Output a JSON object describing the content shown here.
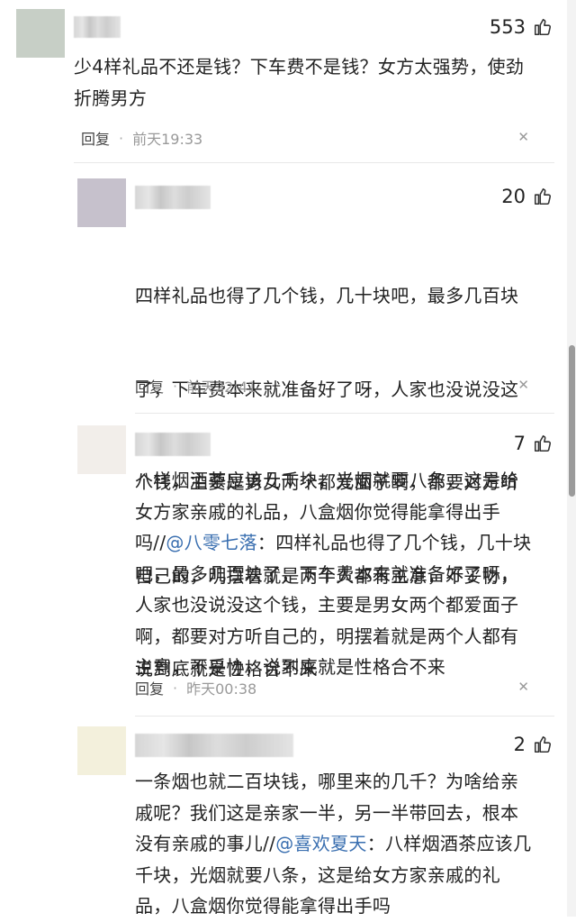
{
  "comments": [
    {
      "likes": "553",
      "text": "少4样礼品不还是钱？下车费不是钱？女方太强势，使劲折腾男方",
      "reply_label": "回复",
      "time": "前天19:33",
      "avatar_color": "#c7cfc6"
    },
    {
      "likes": "20",
      "text_lines": [
        "四样礼品也得了几个钱，几十块吧，最多几百块",
        "了，下车费本来就准备好了呀，人家也没说没这",
        "个钱，主要是男女两个都爱面子啊，都要对方听",
        "自己的，明摆着就是两个人都有主意，不妥协，",
        "说到底就是性格合不来"
      ],
      "reply_label": "回复",
      "time": "前天22:41",
      "avatar_color": "#c6c1cc"
    },
    {
      "likes": "7",
      "text_pre": "八样烟酒茶应该几千块，光烟就要八条，这是给女方家亲戚的礼品，八盒烟你觉得能拿得出手吗//",
      "mention": "@八零七落",
      "text_post": "：四样礼品也得了几个钱，几十块吧，最多几百块了，下车费本来就准备好了呀，人家也没说没这个钱，主要是男女两个都爱面子啊，都要对方听自己的，明摆着就是两个人都有主意，不妥协，说到底就是性格合不来",
      "reply_label": "回复",
      "time": "昨天00:38",
      "avatar_color": "#f2eeea"
    },
    {
      "likes": "2",
      "text_pre": "一条烟也就二百块钱，哪里来的几千？为啥给亲戚呢？我们这是亲家一半，另一半带回去，根本没有亲戚的事儿//",
      "mention": "@喜欢夏天",
      "text_post": "：八样烟酒茶应该几千块，光烟就要八条，这是给女方家亲戚的礼品，八盒烟你觉得能拿得出手吗",
      "avatar_color": "#f3f0dc"
    }
  ],
  "icons": {
    "like": "thumbs-up-icon",
    "close": "close-icon"
  },
  "colors": {
    "mention": "#3a6fb0",
    "time": "#999999",
    "text": "#222222"
  }
}
